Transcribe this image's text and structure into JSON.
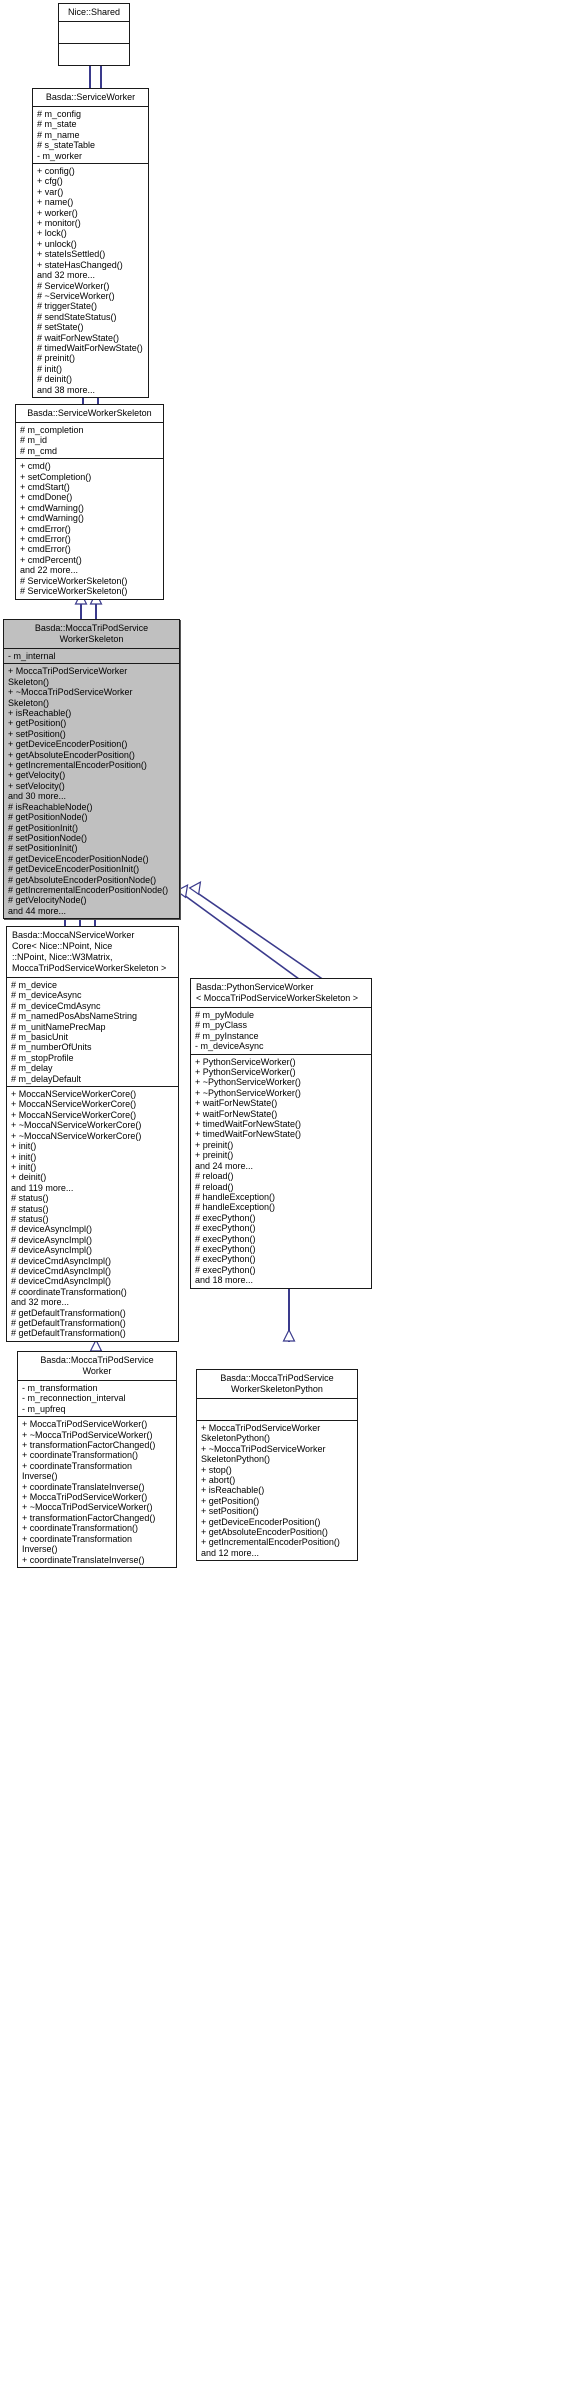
{
  "diagram": {
    "kind": "uml-inheritance-diagram",
    "edge_color": "#3a3a8c",
    "highlight_color": "#c0c0c0",
    "classes": [
      {
        "id": "nice-shared",
        "name": "Nice::Shared",
        "attributes": [],
        "operations": [],
        "highlighted": false
      },
      {
        "id": "basda-serviceworker",
        "name": "Basda::ServiceWorker",
        "attributes": [
          "# m_config",
          "# m_state",
          "# m_name",
          "# s_stateTable",
          "- m_worker"
        ],
        "operations": [
          "+ config()",
          "+ cfg()",
          "+ var()",
          "+ name()",
          "+ worker()",
          "+ monitor()",
          "+ lock()",
          "+ unlock()",
          "+ stateIsSettled()",
          "+ stateHasChanged()",
          "and 32 more...",
          "# ServiceWorker()",
          "# ~ServiceWorker()",
          "# triggerState()",
          "# sendStateStatus()",
          "# setState()",
          "# waitForNewState()",
          "# timedWaitForNewState()",
          "# preinit()",
          "# init()",
          "# deinit()",
          "and 38 more..."
        ],
        "highlighted": false
      },
      {
        "id": "basda-serviceworkerskeleton",
        "name": "Basda::ServiceWorkerSkeleton",
        "attributes": [
          "# m_completion",
          "# m_id",
          "# m_cmd"
        ],
        "operations": [
          "+ cmd()",
          "+ setCompletion()",
          "+ cmdStart()",
          "+ cmdDone()",
          "+ cmdWarning()",
          "+ cmdWarning()",
          "+ cmdError()",
          "+ cmdError()",
          "+ cmdError()",
          "+ cmdPercent()",
          "and 22 more...",
          "# ServiceWorkerSkeleton()",
          "# ServiceWorkerSkeleton()"
        ],
        "highlighted": false
      },
      {
        "id": "basda-moccatripodserviceworkerskeleton",
        "name": "Basda::MoccaTriPodService\nWorkerSkeleton",
        "attributes": [
          "- m_internal"
        ],
        "operations": [
          "+ MoccaTriPodServiceWorker",
          "Skeleton()",
          "+ ~MoccaTriPodServiceWorker",
          "Skeleton()",
          "+ isReachable()",
          "+ getPosition()",
          "+ setPosition()",
          "+ getDeviceEncoderPosition()",
          "+ getAbsoluteEncoderPosition()",
          "+ getIncrementalEncoderPosition()",
          "+ getVelocity()",
          "+ setVelocity()",
          "and 30 more...",
          "# isReachableNode()",
          "# getPositionNode()",
          "# getPositionInit()",
          "# setPositionNode()",
          "# setPositionInit()",
          "# getDeviceEncoderPositionNode()",
          "# getDeviceEncoderPositionInit()",
          "# getAbsoluteEncoderPositionNode()",
          "# getIncrementalEncoderPositionNode()",
          "# getVelocityNode()",
          "and 44 more..."
        ],
        "highlighted": true
      },
      {
        "id": "basda-moccanserviceworkercore",
        "name": "Basda::MoccaNServiceWorker\nCore< Nice::NPoint, Nice\n::NPoint, Nice::W3Matrix,\n MoccaTriPodServiceWorkerSkeleton >",
        "attributes": [
          "# m_device",
          "# m_deviceAsync",
          "# m_deviceCmdAsync",
          "# m_namedPosAbsNameString",
          "# m_unitNamePrecMap",
          "# m_basicUnit",
          "# m_numberOfUnits",
          "# m_stopProfile",
          "# m_delay",
          "# m_delayDefault"
        ],
        "operations": [
          "+ MoccaNServiceWorkerCore()",
          "+ MoccaNServiceWorkerCore()",
          "+ MoccaNServiceWorkerCore()",
          "+ ~MoccaNServiceWorkerCore()",
          "+ ~MoccaNServiceWorkerCore()",
          "+ init()",
          "+ init()",
          "+ init()",
          "+ deinit()",
          "and 119 more...",
          "# status()",
          "# status()",
          "# status()",
          "# deviceAsyncImpl()",
          "# deviceAsyncImpl()",
          "# deviceAsyncImpl()",
          "# deviceCmdAsyncImpl()",
          "# deviceCmdAsyncImpl()",
          "# deviceCmdAsyncImpl()",
          "# coordinateTransformation()",
          "and 32 more...",
          "# getDefaultTransformation()",
          "# getDefaultTransformation()",
          "# getDefaultTransformation()"
        ],
        "highlighted": false
      },
      {
        "id": "basda-pythonserviceworker",
        "name": "Basda::PythonServiceWorker\n< MoccaTriPodServiceWorkerSkeleton >",
        "attributes": [
          "# m_pyModule",
          "# m_pyClass",
          "# m_pyInstance",
          "- m_deviceAsync"
        ],
        "operations": [
          "+ PythonServiceWorker()",
          "+ PythonServiceWorker()",
          "+ ~PythonServiceWorker()",
          "+ ~PythonServiceWorker()",
          "+ waitForNewState()",
          "+ waitForNewState()",
          "+ timedWaitForNewState()",
          "+ timedWaitForNewState()",
          "+ preinit()",
          "+ preinit()",
          "and 24 more...",
          "# reload()",
          "# reload()",
          "# handleException()",
          "# handleException()",
          "# execPython()",
          "# execPython()",
          "# execPython()",
          "# execPython()",
          "# execPython()",
          "# execPython()",
          "and 18 more..."
        ],
        "highlighted": false
      },
      {
        "id": "basda-moccatripodserviceworker",
        "name": "Basda::MoccaTriPodService\nWorker",
        "attributes": [
          "- m_transformation",
          "- m_reconnection_interval",
          "- m_upfreq"
        ],
        "operations": [
          "+ MoccaTriPodServiceWorker()",
          "+ ~MoccaTriPodServiceWorker()",
          "+ transformationFactorChanged()",
          "+ coordinateTransformation()",
          "+ coordinateTransformation",
          "Inverse()",
          "+ coordinateTranslateInverse()",
          "+ MoccaTriPodServiceWorker()",
          "+ ~MoccaTriPodServiceWorker()",
          "+ transformationFactorChanged()",
          "+ coordinateTransformation()",
          "+ coordinateTransformation",
          "Inverse()",
          "+ coordinateTranslateInverse()"
        ],
        "highlighted": false
      },
      {
        "id": "basda-moccatripodserviceworkerskeletonpython",
        "name": "Basda::MoccaTriPodService\nWorkerSkeletonPython",
        "attributes": [],
        "operations": [
          "+ MoccaTriPodServiceWorker",
          "SkeletonPython()",
          "+ ~MoccaTriPodServiceWorker",
          "SkeletonPython()",
          "+ stop()",
          "+ abort()",
          "+ isReachable()",
          "+ getPosition()",
          "+ setPosition()",
          "+ getDeviceEncoderPosition()",
          "+ getAbsoluteEncoderPosition()",
          "+ getIncrementalEncoderPosition()",
          "and 12 more..."
        ],
        "highlighted": false
      }
    ]
  }
}
